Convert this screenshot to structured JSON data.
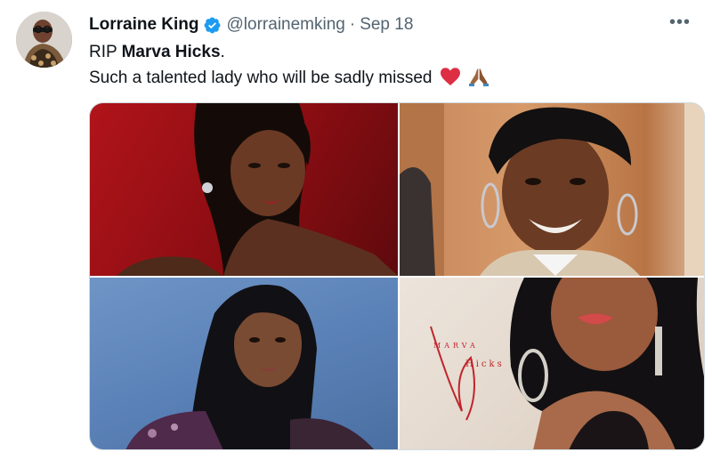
{
  "author": {
    "name": "Lorraine King",
    "handle": "@lorrainemking",
    "separator": "·",
    "date": "Sep 18"
  },
  "tweet": {
    "line1_prefix": "RIP ",
    "line1_bold": "Marva Hicks",
    "line1_suffix": ".",
    "line2": "Such a talented lady who will be sadly missed"
  },
  "icons": {
    "verified": "verified-badge-icon",
    "more": "more-options-icon",
    "heart": "red-heart-emoji",
    "pray": "folded-hands-emoji"
  },
  "more_label": "•••",
  "album": {
    "artist": "MARVA",
    "title": "Hicks"
  },
  "colors": {
    "verified": "#1d9bf0",
    "secondary_text": "#536471",
    "primary_text": "#0f1419",
    "border": "#cfd9de",
    "heart": "#e0245e"
  }
}
